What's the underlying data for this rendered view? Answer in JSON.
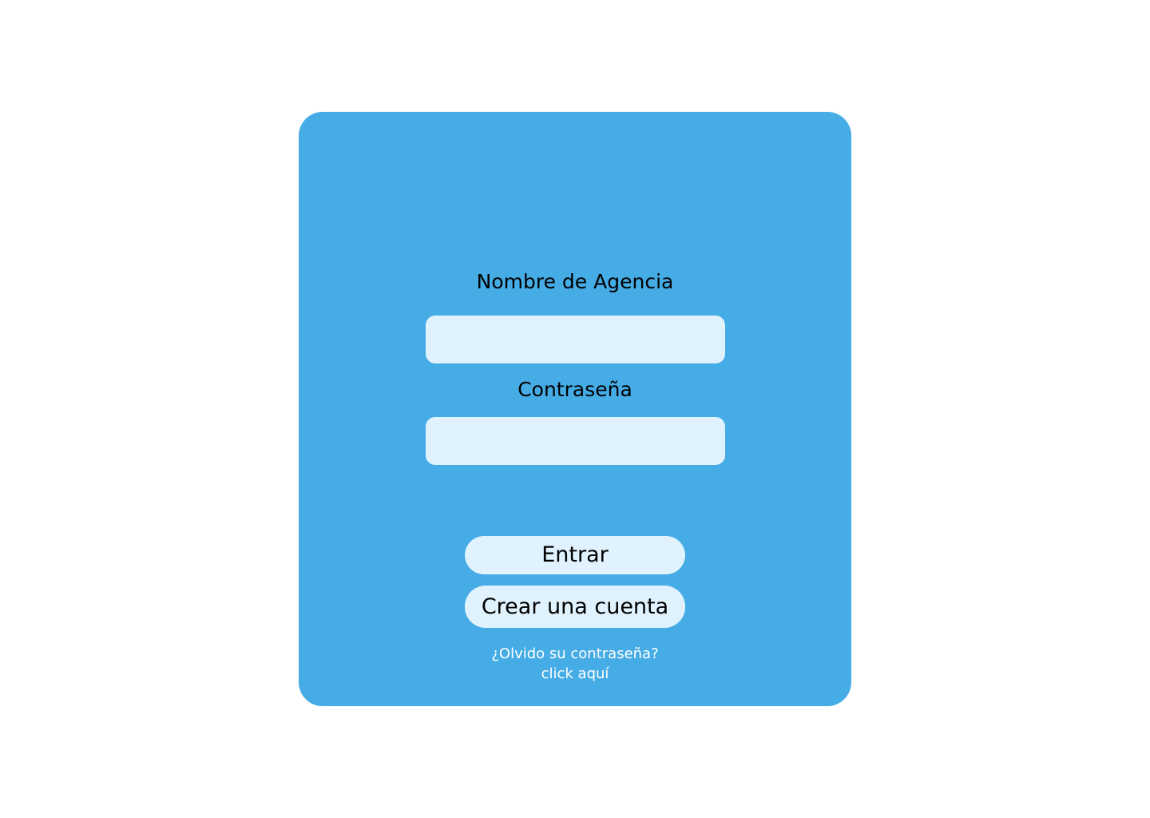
{
  "login": {
    "agency_label": "Nombre de Agencia",
    "agency_value": "",
    "password_label": "Contraseña",
    "password_value": "",
    "login_button": "Entrar",
    "register_button": "Crear una cuenta",
    "forgot_question": "¿Olvido su contraseña?",
    "forgot_link": "click aquí"
  },
  "colors": {
    "background": "#FFFFFF",
    "card": "#45ACE6",
    "field": "#DFF2FD",
    "text": "#000000",
    "link_text": "#FFFFFF"
  }
}
